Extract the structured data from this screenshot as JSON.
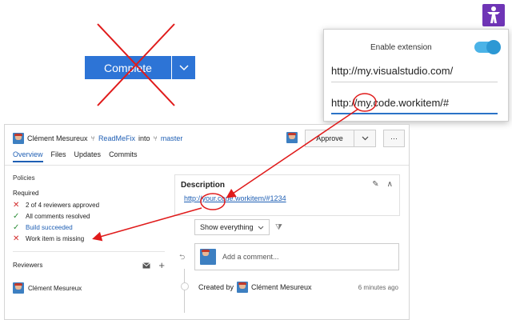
{
  "complete_button": {
    "label": "Complete"
  },
  "extension_popup": {
    "enable_label": "Enable extension",
    "enabled": true,
    "url_field_1": "http://my.visualstudio.com/",
    "url_field_2": "http://my.code.workitem/#"
  },
  "pr": {
    "author": "Clément Mesureux",
    "source_branch": "ReadMeFix",
    "into_word": "into",
    "target_branch": "master",
    "approve_label": "Approve",
    "more_label": "···",
    "tabs": [
      "Overview",
      "Files",
      "Updates",
      "Commits"
    ]
  },
  "policies": {
    "title": "Policies",
    "required_label": "Required",
    "items": [
      {
        "status": "fail",
        "text": "2 of 4 reviewers approved"
      },
      {
        "status": "pass",
        "text": "All comments resolved"
      },
      {
        "status": "pass",
        "text": "Build succeeded"
      },
      {
        "status": "fail",
        "text": "Work item is missing"
      }
    ]
  },
  "reviewers": {
    "title": "Reviewers",
    "add_label": "+",
    "items": [
      "Clément Mesureux"
    ]
  },
  "description": {
    "title": "Description",
    "link": "http://your.code.workitem/#1234"
  },
  "activity": {
    "filter_value": "Show everything",
    "comment_placeholder": "Add a comment...",
    "created_by_label": "Created by",
    "created_by_name": "Clément Mesureux",
    "created_time": "6 minutes ago"
  },
  "colors": {
    "accent": "#2d74d6",
    "annotation": "#e01b1b",
    "toggle": "#4bb3e7",
    "extension": "#6f35b6"
  }
}
